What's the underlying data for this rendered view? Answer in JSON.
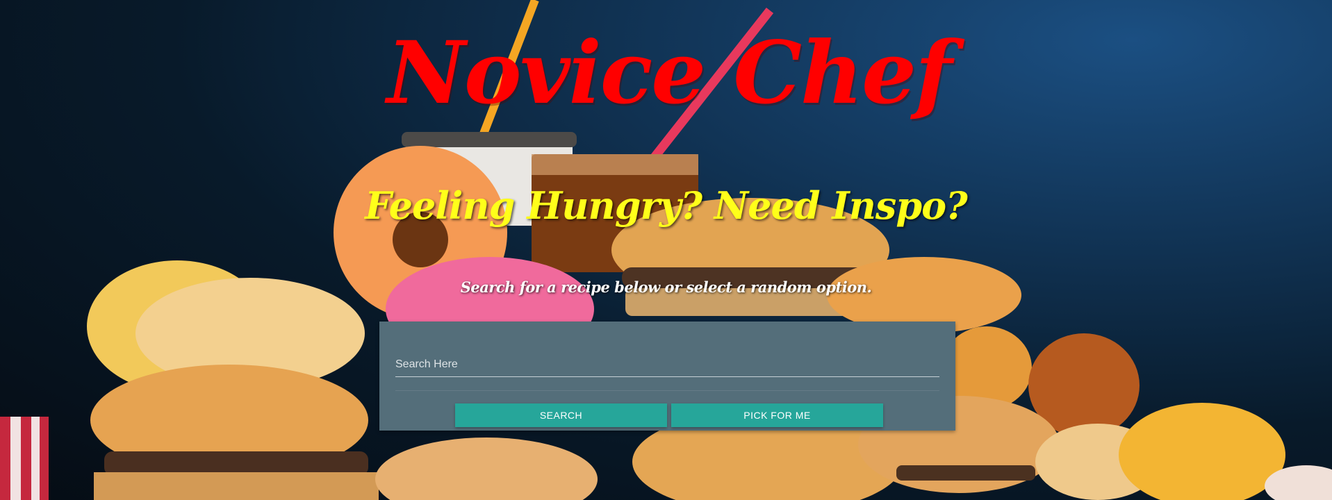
{
  "app": {
    "title": "Novice Chef"
  },
  "hero": {
    "subtitle": "Feeling Hungry? Need Inspo?",
    "tagline": "Search for a recipe below or select a random option."
  },
  "search": {
    "placeholder": "Search Here",
    "value": "",
    "search_button_label": "SEARCH",
    "random_button_label": "PICK FOR ME"
  },
  "colors": {
    "title": "#ff0000",
    "subtitle": "#ffff1a",
    "card": "#546e7a",
    "button": "#26a69a"
  },
  "icons": {
    "background": "fast-food-photo"
  }
}
